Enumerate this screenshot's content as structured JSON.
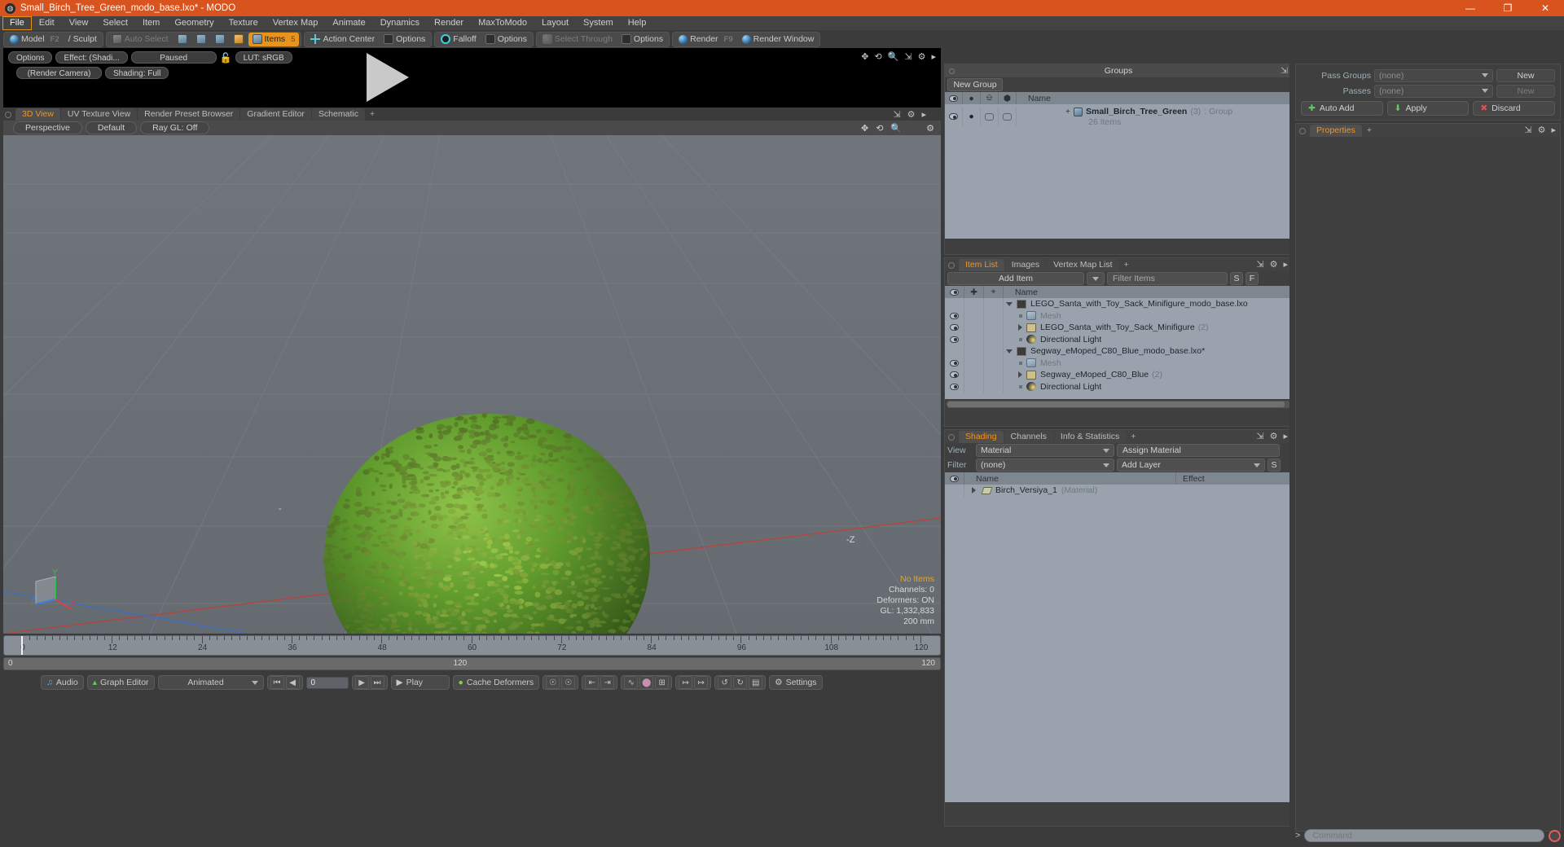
{
  "window": {
    "title": "Small_Birch_Tree_Green_modo_base.lxo* - MODO",
    "logo_glyph": "◍",
    "minimize": "—",
    "maximize": "❐",
    "close": "✕"
  },
  "menu": {
    "items": [
      "File",
      "Edit",
      "View",
      "Select",
      "Item",
      "Geometry",
      "Texture",
      "Vertex Map",
      "Animate",
      "Dynamics",
      "Render",
      "MaxToModo",
      "Layout",
      "System",
      "Help"
    ],
    "active": "File"
  },
  "modebar": {
    "model": "Model",
    "model_key": "F2",
    "sculpt": "Sculpt",
    "auto_select": "Auto Select",
    "items": "Items",
    "items_key": "5",
    "action_center": "Action Center",
    "options1": "Options",
    "falloff": "Falloff",
    "options2": "Options",
    "select_through": "Select Through",
    "options3": "Options",
    "render": "Render",
    "render_key": "F9",
    "render_window": "Render Window"
  },
  "render_preview": {
    "options": "Options",
    "effect": "Effect: (Shadi...",
    "paused": "Paused",
    "lut": "LUT: sRGB",
    "camera": "(Render Camera)",
    "shading": "Shading: Full"
  },
  "viewport_tabs": {
    "items": [
      "3D View",
      "UV Texture View",
      "Render Preset Browser",
      "Gradient Editor",
      "Schematic"
    ],
    "active": "3D View",
    "add": "+"
  },
  "viewport_header": {
    "perspective": "Perspective",
    "default": "Default",
    "raygl": "Ray GL: Off"
  },
  "viewport": {
    "stats": {
      "no_items": "No Items",
      "channels": "Channels: 0",
      "deformers": "Deformers: ON",
      "gl": "GL: 1,332,833",
      "scale": "200 mm"
    },
    "axis": {
      "x": "X",
      "y": "Y",
      "z": "Z",
      "neg_z": "-Z"
    }
  },
  "timeline": {
    "ticks": [
      "0",
      "12",
      "24",
      "36",
      "48",
      "60",
      "72",
      "84",
      "96",
      "108",
      "120"
    ],
    "range_start": "0",
    "range_mid": "120",
    "range_end": "120"
  },
  "bottombar": {
    "audio": "Audio",
    "graph_editor": "Graph Editor",
    "animated": "Animated",
    "frame_value": "0",
    "play": "Play",
    "cache_deformers": "Cache Deformers",
    "settings": "Settings"
  },
  "groups_panel": {
    "title": "Groups",
    "new_group": "New Group",
    "columns": [
      "eye",
      "camera",
      "cube-outline",
      "cube-solid",
      "Name"
    ],
    "name_header": "Name",
    "rows": [
      {
        "name": "Small_Birch_Tree_Green",
        "count": "(3)",
        "type": ": Group",
        "sub": "26 Items",
        "expander": "+"
      }
    ]
  },
  "item_list_panel": {
    "tabs": [
      "Item List",
      "Images",
      "Vertex Map List"
    ],
    "active_tab": "Item List",
    "add": "+",
    "add_item": "Add Item",
    "filter_placeholder": "Filter Items",
    "filter_s": "S",
    "filter_f": "F",
    "name_header": "Name",
    "rows": [
      {
        "label": "LEGO_Santa_with_Toy_Sack_Minifigure_modo_base.lxo",
        "count": "",
        "icon": "scene-icon",
        "indent": 0,
        "expander": "down",
        "dim": false,
        "eye": false
      },
      {
        "label": "Mesh",
        "count": "",
        "icon": "mesh-icon",
        "indent": 1,
        "expander": "none",
        "dim": true,
        "eye": true
      },
      {
        "label": "LEGO_Santa_with_Toy_Sack_Minifigure",
        "count": "(2)",
        "icon": "group-icon",
        "indent": 1,
        "expander": "right",
        "dim": false,
        "eye": true
      },
      {
        "label": "Directional Light",
        "count": "",
        "icon": "light-icon",
        "indent": 1,
        "expander": "none",
        "dim": false,
        "eye": true
      },
      {
        "label": "Segway_eMoped_C80_Blue_modo_base.lxo*",
        "count": "",
        "icon": "scene-icon",
        "indent": 0,
        "expander": "down",
        "dim": false,
        "eye": false
      },
      {
        "label": "Mesh",
        "count": "",
        "icon": "mesh-icon",
        "indent": 1,
        "expander": "none",
        "dim": true,
        "eye": true
      },
      {
        "label": "Segway_eMoped_C80_Blue",
        "count": "(2)",
        "icon": "group-icon",
        "indent": 1,
        "expander": "right",
        "dim": false,
        "eye": true
      },
      {
        "label": "Directional Light",
        "count": "",
        "icon": "light-icon",
        "indent": 1,
        "expander": "none",
        "dim": false,
        "eye": true
      }
    ]
  },
  "shading_panel": {
    "tabs": [
      "Shading",
      "Channels",
      "Info & Statistics"
    ],
    "active_tab": "Shading",
    "add": "+",
    "view_label": "View",
    "view_value": "Material",
    "assign_material": "Assign Material",
    "filter_label": "Filter",
    "filter_value": "(none)",
    "add_layer": "Add Layer",
    "add_layer_s": "S",
    "name_header": "Name",
    "effect_header": "Effect",
    "rows": [
      {
        "name": "Birch_Versiya_1",
        "type": "(Material)",
        "effect": ""
      }
    ]
  },
  "properties_panel": {
    "pass_groups_label": "Pass Groups",
    "pass_groups_value": "(none)",
    "pass_groups_new": "New",
    "passes_label": "Passes",
    "passes_value": "(none)",
    "passes_new": "New",
    "auto_add": "Auto Add",
    "apply": "Apply",
    "discard": "Discard",
    "tab": "Properties",
    "add": "+"
  },
  "command_bar": {
    "prompt": ">",
    "placeholder": "Command"
  },
  "colors": {
    "title_bar": "#d9531e",
    "accent": "#f09320",
    "panel_bg": "#3f3f3f",
    "list_bg": "#9aa3ad",
    "viewport_bg": "#6c7278",
    "leaf_green": "#6fae34",
    "axis_x": "#c0392b",
    "axis_y": "#27ae60",
    "axis_z": "#2d6fd0"
  }
}
